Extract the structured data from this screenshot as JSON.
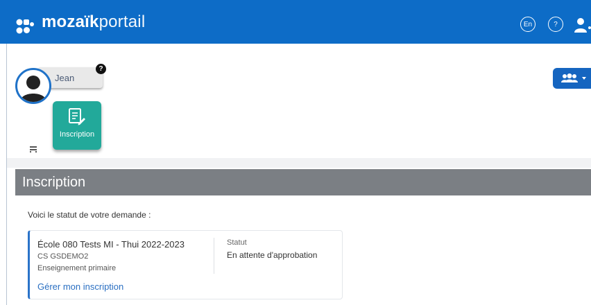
{
  "header": {
    "brand_bold": "mozaïk",
    "brand_light": "portail",
    "lang_button": "En",
    "help_button": "?",
    "accent": "#0d6cc7"
  },
  "profile": {
    "name": "Jean",
    "help_badge": "?"
  },
  "apps": [
    {
      "label": "Inscription",
      "icon": "form-edit-icon",
      "color": "#22a99a"
    }
  ],
  "section": {
    "title": "Inscription",
    "intro": "Voici le statut de votre demande :"
  },
  "request": {
    "school": "École 080 Tests MI - Thui 2022-2023",
    "code": "CS GSDEMO2",
    "level": "Enseignement primaire",
    "manage_link": "Gérer mon inscription",
    "status_label": "Statut",
    "status_value": "En attente d'approbation"
  }
}
